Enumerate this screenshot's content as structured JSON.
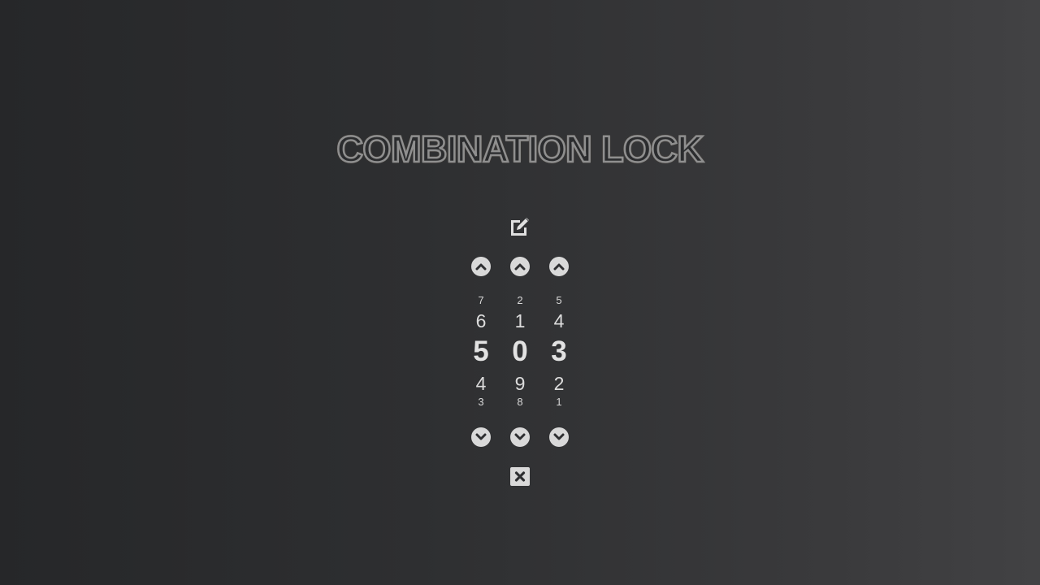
{
  "title": "COMBINATION LOCK",
  "controls": {
    "edit_icon": "edit-icon",
    "close_icon": "close-icon",
    "up_icon": "chevron-up-circle-icon",
    "down_icon": "chevron-down-circle-icon"
  },
  "dials": [
    {
      "above2": "7",
      "above1": "6",
      "current": "5",
      "below1": "4",
      "below2": "3"
    },
    {
      "above2": "2",
      "above1": "1",
      "current": "0",
      "below1": "9",
      "below2": "8"
    },
    {
      "above2": "5",
      "above1": "4",
      "current": "3",
      "below1": "2",
      "below2": "1"
    }
  ],
  "colors": {
    "background_dark": "#262729",
    "background_light": "#424244",
    "icon": "#d9d9d9",
    "title_glow": "#c7a170"
  }
}
